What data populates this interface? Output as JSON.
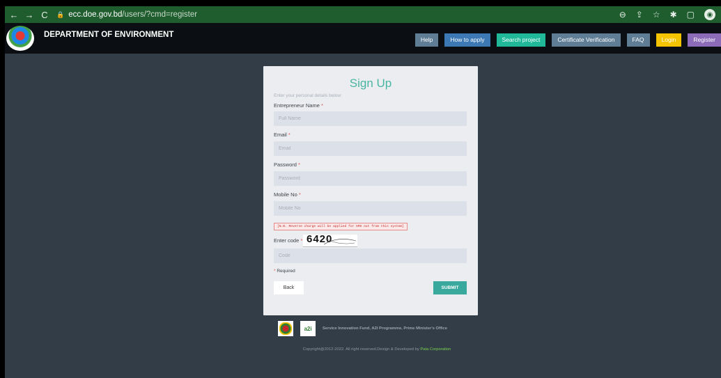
{
  "browser": {
    "back_icon": "←",
    "forward_icon": "→",
    "reload_icon": "C",
    "url_host": "ecc.doe.gov.bd",
    "url_path": "/users/?cmd=register"
  },
  "header": {
    "title": "DEPARTMENT OF ENVIRONMENT",
    "nav": [
      {
        "label": "Help",
        "color": "#5f7d95"
      },
      {
        "label": "How to apply",
        "color": "#3c79b4"
      },
      {
        "label": "Search project",
        "color": "#1fb99a"
      },
      {
        "label": "Certificate Verification",
        "color": "#5f7d95"
      },
      {
        "label": "FAQ",
        "color": "#5f7d95"
      },
      {
        "label": "Login",
        "color": "#f5c400"
      },
      {
        "label": "Register",
        "color": "#8c6bb8"
      }
    ]
  },
  "form": {
    "title": "Sign Up",
    "subtitle": "Enter your personal details below:",
    "name_label": "Entrepreneur Name",
    "name_placeholder": "Full Name",
    "email_label": "Email",
    "email_placeholder": "Email",
    "password_label": "Password",
    "password_placeholder": "Password",
    "mobile_label": "Mobile No",
    "mobile_placeholder": "Mobile No",
    "sms_note": "[N.B. Reverse charge will be applied for SMS out from this system]",
    "code_label": "Enter code",
    "captcha_code": "6420",
    "code_placeholder": "Code",
    "required_star": "*",
    "required_note": "Required",
    "back_label": "Back",
    "submit_label": "SUBMIT"
  },
  "footer": {
    "a2i_text": "Service Innovation Fund, A2I Programme, Prime Minister's Office",
    "a2i_badge": "a2i",
    "copyright": "Copyright@2012-2022. All right reserved.Design & Developed by ",
    "developer": "Pata Corporation"
  },
  "colors": {
    "browser_bar": "#1f5c2e",
    "header_bg": "#0b0f13",
    "page_bg": "#323d48",
    "card_bg": "#ebedf1",
    "accent": "#48b6a0",
    "submit": "#3aa99d"
  }
}
